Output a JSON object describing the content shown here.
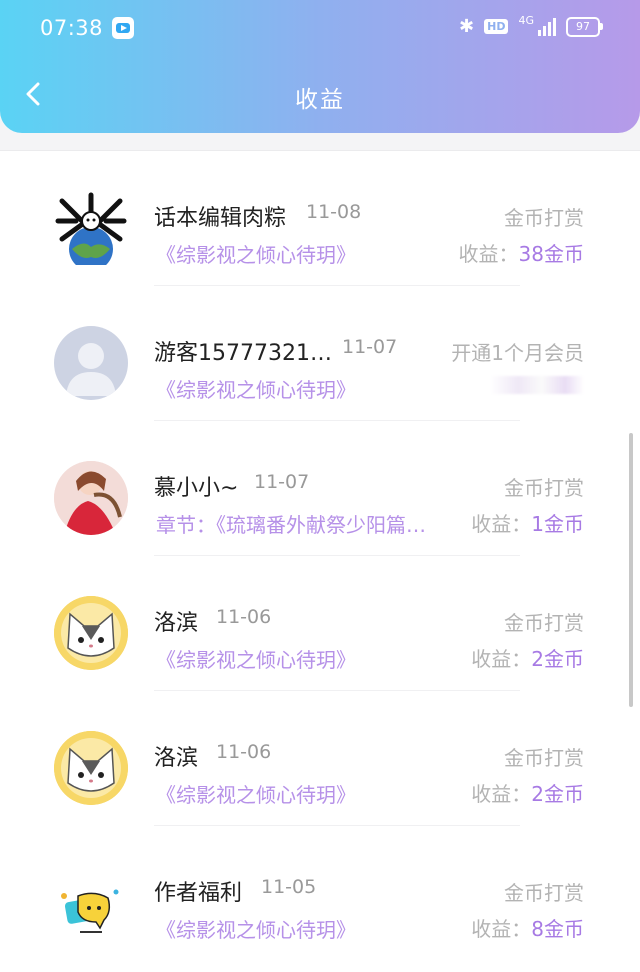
{
  "status_bar": {
    "time": "07:38",
    "app_icon": "video-app-icon",
    "hd": "HD",
    "network": "4G",
    "battery": "97"
  },
  "header": {
    "title": "收益",
    "back_icon": "chevron-left-icon"
  },
  "items": [
    {
      "name": "话本编辑肉粽",
      "date": "11-08",
      "type": "金币打赏",
      "work": "《综影视之倾心待玥》",
      "income_label": "收益：",
      "income_amount": "38金币"
    },
    {
      "name": "游客15777321…",
      "date": "11-07",
      "type": "开通1个月会员",
      "work": "《综影视之倾心待玥》",
      "income_label": "",
      "income_amount": ""
    },
    {
      "name": "慕小小~",
      "date": "11-07",
      "type": "金币打赏",
      "work": "章节：《琉璃番外献祭少阳篇…",
      "income_label": "收益：",
      "income_amount": "1金币"
    },
    {
      "name": "洛滨",
      "date": "11-06",
      "type": "金币打赏",
      "work": "《综影视之倾心待玥》",
      "income_label": "收益：",
      "income_amount": "2金币"
    },
    {
      "name": "洛滨",
      "date": "11-06",
      "type": "金币打赏",
      "work": "《综影视之倾心待玥》",
      "income_label": "收益：",
      "income_amount": "2金币"
    },
    {
      "name": "作者福利",
      "date": "11-05",
      "type": "金币打赏",
      "work": "《综影视之倾心待玥》",
      "income_label": "收益：",
      "income_amount": "8金币"
    }
  ],
  "colors": {
    "header_gradient_start": "#5ad3f4",
    "header_gradient_end": "#b69ae9",
    "accent_purple": "#a77ae4"
  }
}
